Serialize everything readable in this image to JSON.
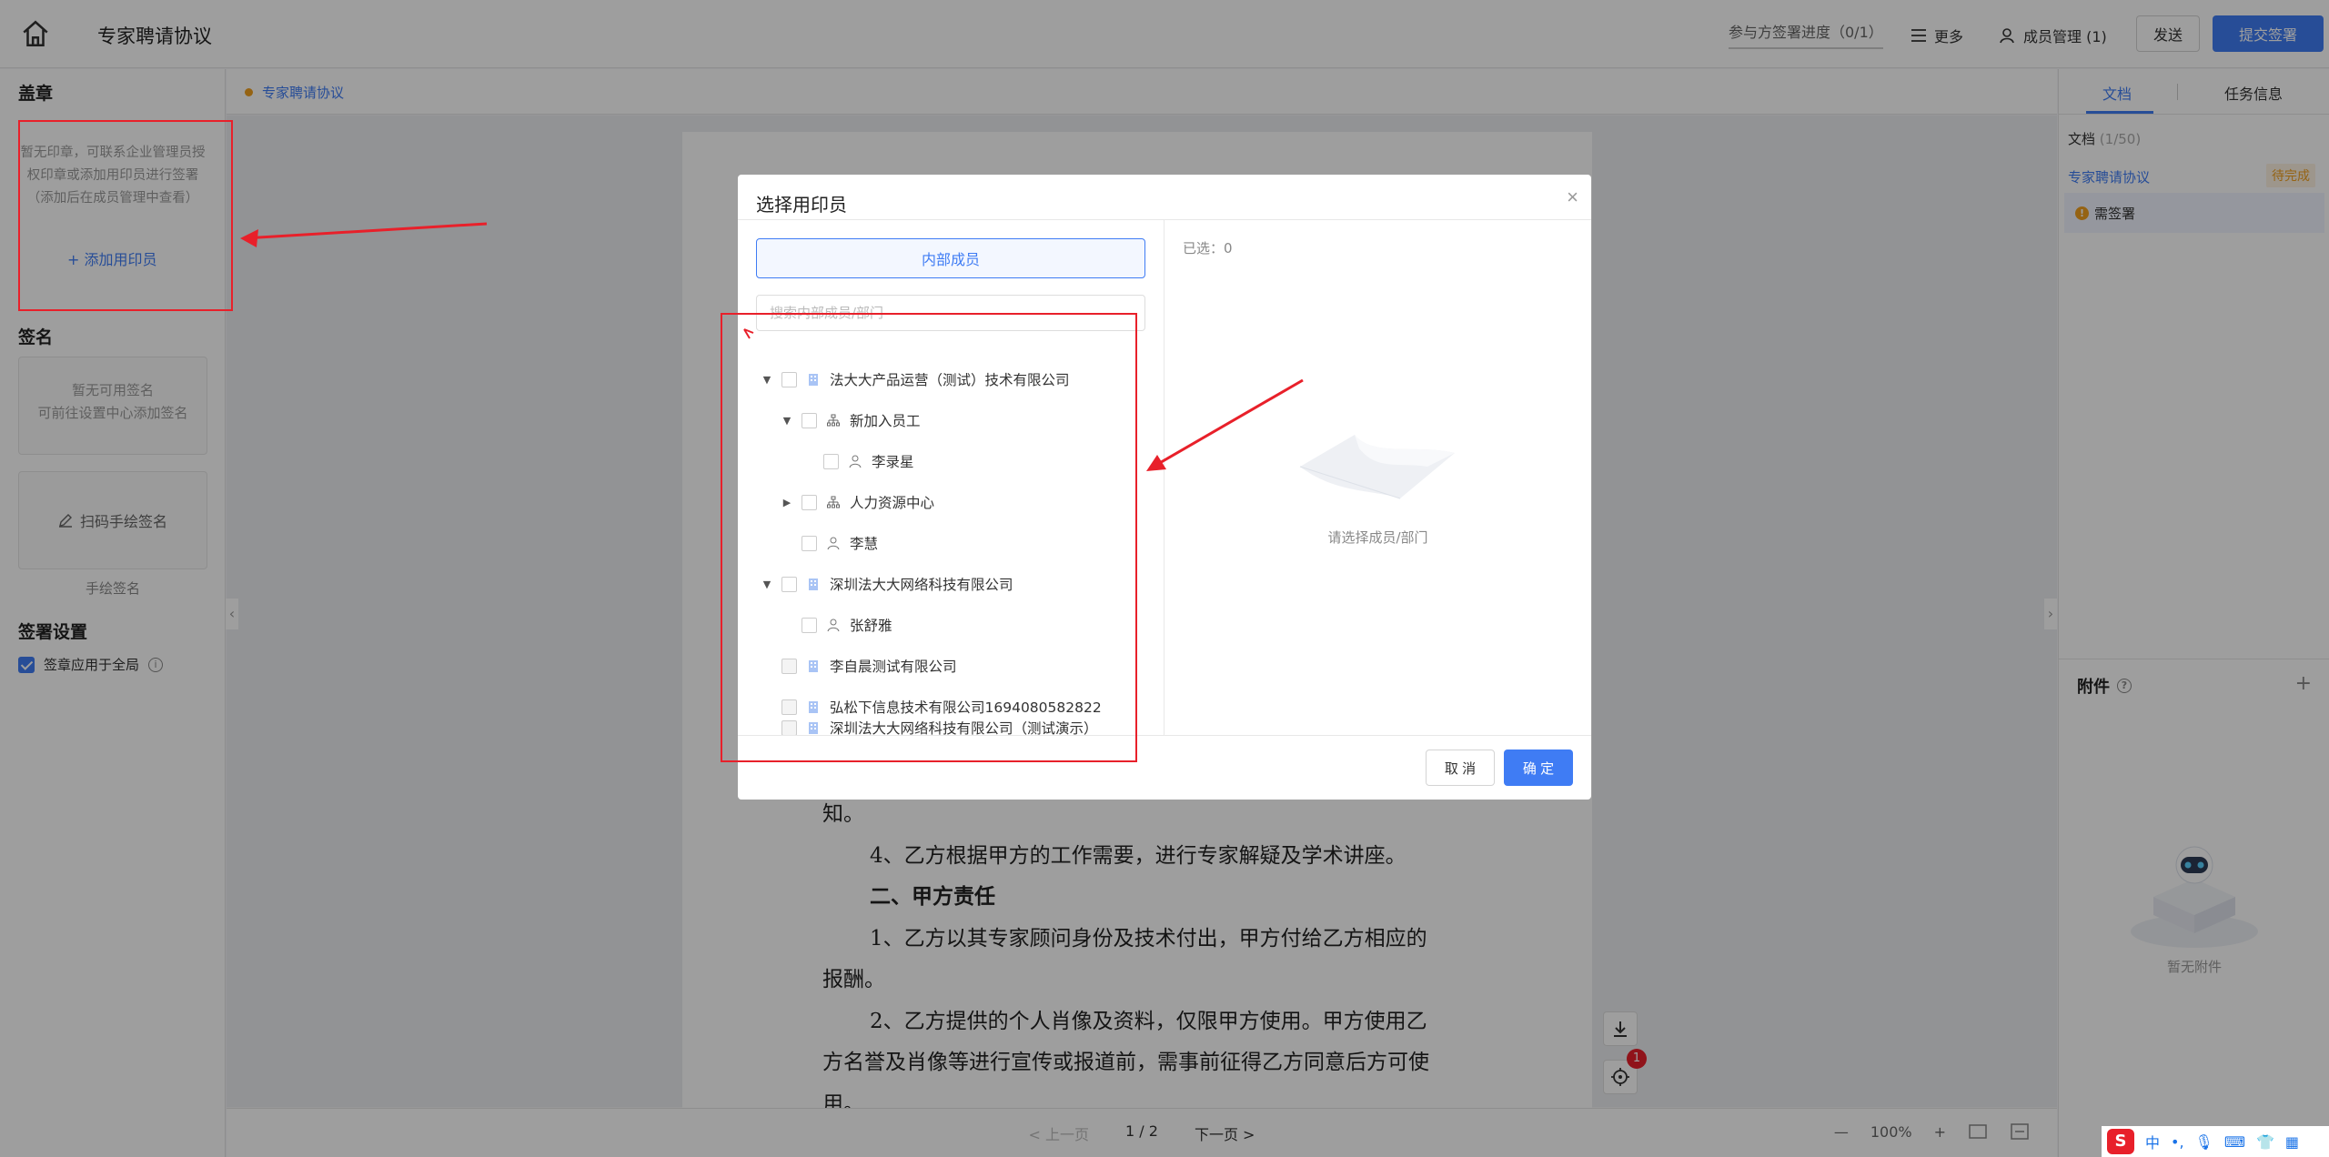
{
  "header": {
    "title": "专家聘请协议",
    "progress": "参与方签署进度（0/1）",
    "more": "更多",
    "members": "成员管理 (1)",
    "send": "发送",
    "submit": "提交签署"
  },
  "left": {
    "seal_title": "盖章",
    "seal_empty": "暂无印章，可联系企业管理员授权印章或添加用印员进行签署（添加后在成员管理中查看）",
    "add_seal_user": "+ 添加用印员",
    "sign_title": "签名",
    "sign_empty_line1": "暂无可用签名",
    "sign_empty_line2": "可前往设置中心添加签名",
    "scan_sign": "扫码手绘签名",
    "hand_sign_caption": "手绘签名",
    "settings_title": "签署设置",
    "apply_all": "签章应用于全局"
  },
  "doc": {
    "tab_name": "专家聘请协议",
    "lines": [
      "知。",
      "4、乙方根据甲方的工作需要，进行专家解疑及学术讲座。",
      "二、甲方责任",
      "1、乙方以其专家顾问身份及技术付出，甲方付给乙方相应的",
      "报酬。",
      "2、乙方提供的个人肖像及资料，仅限甲方使用。甲方使用乙",
      "方名誉及肖像等进行宣传或报道前，需事前征得乙方同意后方可使",
      "用。"
    ],
    "prev": "< 上一页",
    "page": "1 / 2",
    "next": "下一页 >",
    "zoom": "100%",
    "zoom_minus": "—",
    "zoom_plus": "+",
    "badge": "1"
  },
  "right": {
    "tab_doc": "文档",
    "tab_task": "任务信息",
    "doc_count_label": "文档",
    "doc_count_value": "(1/50)",
    "doc_name": "专家聘请协议",
    "doc_status": "待完成",
    "need_sign": "需签署",
    "attach_title": "附件",
    "attach_add": "+",
    "no_attach": "暂无附件"
  },
  "modal": {
    "title": "选择用印员",
    "tab_internal": "内部成员",
    "search_placeholder": "搜索内部成员/部门",
    "selected": "已选：0",
    "empty_hint": "请选择成员/部门",
    "cancel": "取 消",
    "ok": "确 定",
    "tree": [
      {
        "label": "法大大产品运营（测试）技术有限公司",
        "type": "company",
        "caret": "▼"
      },
      {
        "label": "新加入员工",
        "type": "dept",
        "caret": "▼"
      },
      {
        "label": "李录星",
        "type": "person",
        "caret": ""
      },
      {
        "label": "人力资源中心",
        "type": "dept",
        "caret": "▶"
      },
      {
        "label": "李慧",
        "type": "person",
        "caret": ""
      },
      {
        "label": "深圳法大大网络科技有限公司",
        "type": "company",
        "caret": "▼"
      },
      {
        "label": "张舒雅",
        "type": "person",
        "caret": ""
      },
      {
        "label": "李自晨测试有限公司",
        "type": "company",
        "caret": ""
      },
      {
        "label": "弘松下信息技术有限公司1694080582822",
        "type": "company",
        "caret": ""
      },
      {
        "label": "深圳法大大网络科技有限公司（测试演示）",
        "type": "company",
        "caret": ""
      }
    ]
  },
  "ime": {
    "logo": "S",
    "lang": "中"
  }
}
